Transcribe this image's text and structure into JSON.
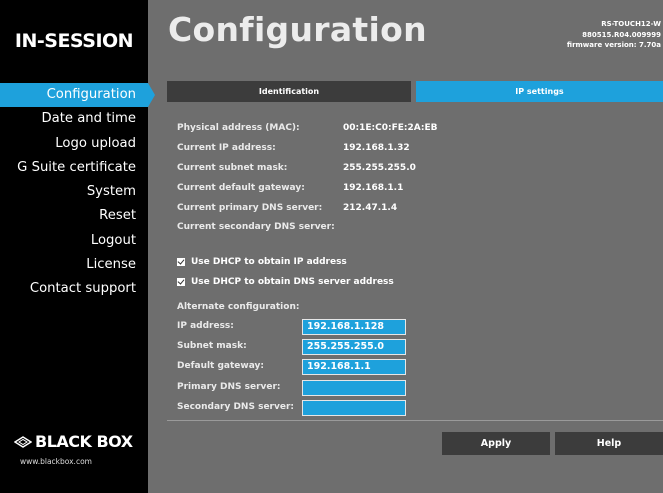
{
  "brand": {
    "name": "IN-SESSION"
  },
  "header": {
    "title": "Configuration",
    "device_model": "RS-TOUCH12-W",
    "device_serial": "880515.R04.009999",
    "firmware": "firmware version: 7.70a"
  },
  "sidebar": {
    "items": [
      {
        "label": "Configuration",
        "active": true
      },
      {
        "label": "Date and time"
      },
      {
        "label": "Logo upload"
      },
      {
        "label": "G Suite certificate"
      },
      {
        "label": "System"
      },
      {
        "label": "Reset"
      },
      {
        "label": "Logout"
      },
      {
        "label": "License"
      },
      {
        "label": "Contact support"
      }
    ]
  },
  "logo": {
    "name": "BLACK BOX",
    "url": "www.blackbox.com"
  },
  "tabs": [
    {
      "label": "Identification",
      "active": false
    },
    {
      "label": "IP settings",
      "active": true
    }
  ],
  "info": [
    {
      "label": "Physical address (MAC):",
      "value": "00:1E:C0:FE:2A:EB"
    },
    {
      "label": "Current IP address:",
      "value": "192.168.1.32"
    },
    {
      "label": "Current subnet mask:",
      "value": "255.255.255.0"
    },
    {
      "label": "Current default gateway:",
      "value": "192.168.1.1"
    },
    {
      "label": "Current primary DNS server:",
      "value": "212.47.1.4"
    },
    {
      "label": "Current secondary DNS server:",
      "value": ""
    }
  ],
  "checkboxes": [
    {
      "label": "Use DHCP to obtain IP address",
      "checked": true
    },
    {
      "label": "Use DHCP to obtain DNS server address",
      "checked": true
    }
  ],
  "alternate": {
    "title": "Alternate configuration:",
    "fields": [
      {
        "label": "IP address:",
        "value": "192.168.1.128"
      },
      {
        "label": "Subnet mask:",
        "value": "255.255.255.0"
      },
      {
        "label": "Default gateway:",
        "value": "192.168.1.1"
      },
      {
        "label": "Primary DNS server:",
        "value": ""
      },
      {
        "label": "Secondary DNS server:",
        "value": ""
      }
    ]
  },
  "buttons": {
    "apply": "Apply",
    "help": "Help"
  },
  "colors": {
    "accent": "#1ea1dc",
    "panel": "#6e6e6e",
    "sidebar": "#000000",
    "button": "#3c3c3c"
  }
}
